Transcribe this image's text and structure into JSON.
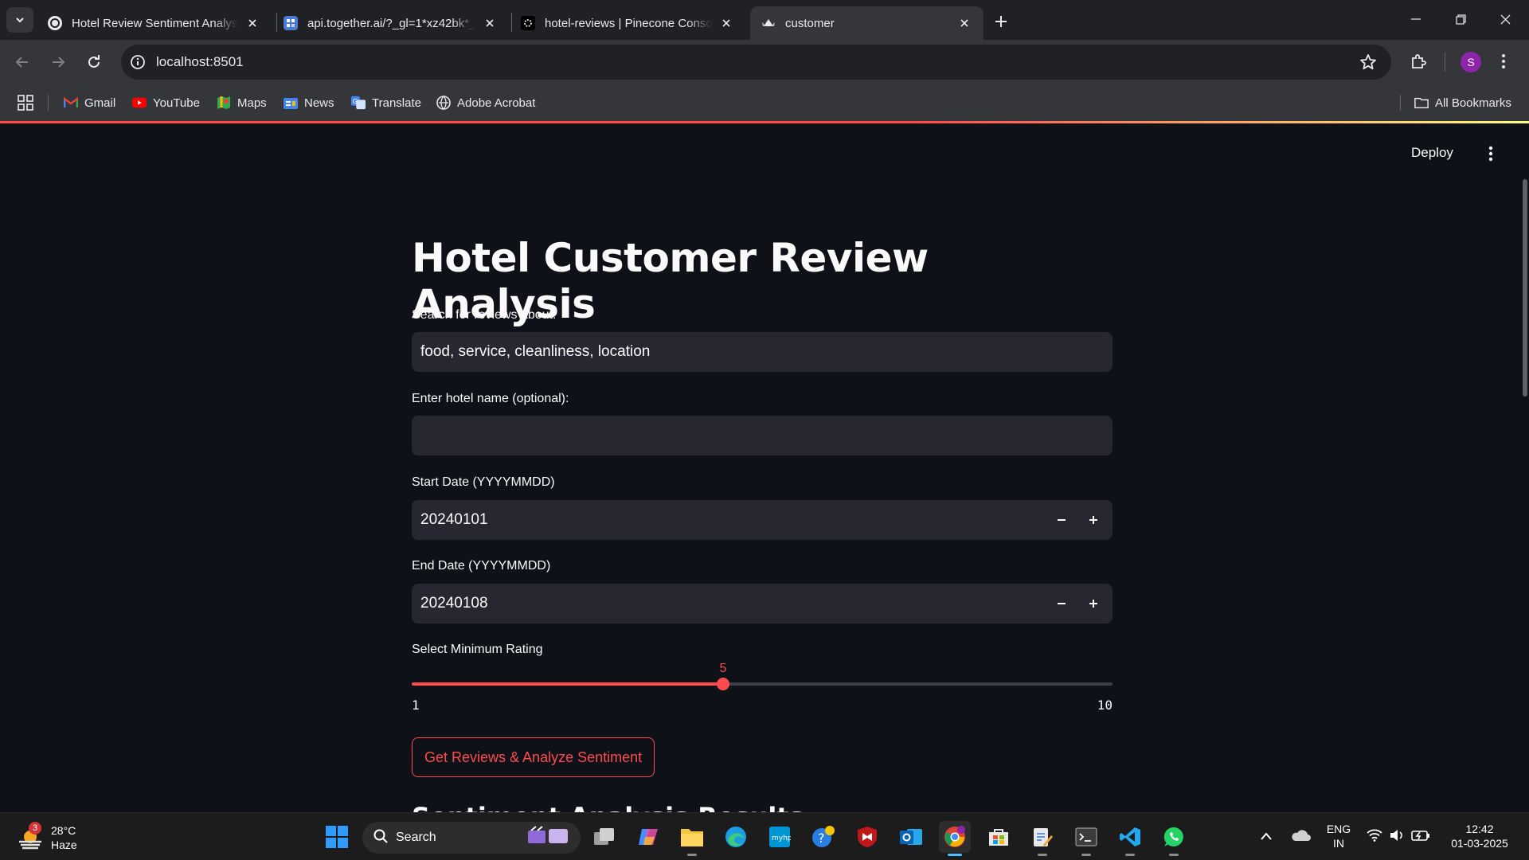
{
  "browser": {
    "tabs": [
      {
        "title": "Hotel Review Sentiment Analysis",
        "active": false
      },
      {
        "title": "api.together.ai/?_gl=1*xz42bk*_",
        "active": false
      },
      {
        "title": "hotel-reviews | Pinecone Console",
        "active": false
      },
      {
        "title": "customer",
        "active": true
      }
    ],
    "url": "localhost:8501",
    "profile_initial": "S",
    "bookmarks": [
      {
        "label": "Gmail",
        "icon": "gmail-icon"
      },
      {
        "label": "YouTube",
        "icon": "youtube-icon"
      },
      {
        "label": "Maps",
        "icon": "maps-icon"
      },
      {
        "label": "News",
        "icon": "news-icon"
      },
      {
        "label": "Translate",
        "icon": "translate-icon"
      },
      {
        "label": "Adobe Acrobat",
        "icon": "acrobat-icon"
      }
    ],
    "all_bookmarks": "All Bookmarks"
  },
  "app": {
    "deploy_label": "Deploy",
    "title": "Hotel Customer Review Analysis",
    "search": {
      "label": "Search for reviews about:",
      "value": "food, service, cleanliness, location"
    },
    "hotel": {
      "label": "Enter hotel name (optional):",
      "value": ""
    },
    "start_date": {
      "label": "Start Date (YYYYMMDD)",
      "value": "20240101"
    },
    "end_date": {
      "label": "End Date (YYYYMMDD)",
      "value": "20240108"
    },
    "rating": {
      "label": "Select Minimum Rating",
      "value": "5",
      "min": "1",
      "max": "10"
    },
    "button_label": "Get Reviews & Analyze Sentiment",
    "next_heading": "Sentiment Analysis Results"
  },
  "colors": {
    "accent": "#ff4b4b",
    "background": "#0e1117",
    "input_bg": "#262730"
  },
  "taskbar": {
    "weather": {
      "temp": "28°C",
      "condition": "Haze",
      "badge": "3"
    },
    "search_label": "Search",
    "lang": {
      "line1": "ENG",
      "line2": "IN"
    },
    "time": "12:42",
    "date": "01-03-2025"
  }
}
